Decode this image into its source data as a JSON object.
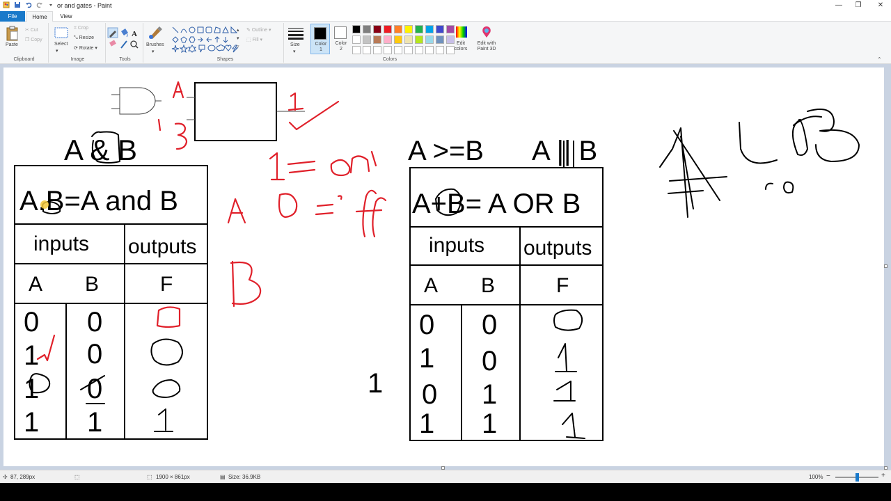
{
  "window": {
    "title": "or and gates - Paint",
    "minimize_glyph": "—",
    "maximize_glyph": "❐",
    "close_glyph": "✕"
  },
  "tabs": {
    "file": "File",
    "home": "Home",
    "view": "View"
  },
  "ribbon": {
    "clipboard": {
      "paste": "Paste",
      "cut": "Cut",
      "copy": "Copy",
      "label": "Clipboard"
    },
    "image": {
      "select": "Select",
      "crop": "Crop",
      "resize": "Resize",
      "rotate": "Rotate",
      "label": "Image"
    },
    "tools": {
      "label": "Tools",
      "brushes": "Brushes"
    },
    "shapes": {
      "outline": "Outline",
      "fill": "Fill",
      "label": "Shapes"
    },
    "size": {
      "label": "Size"
    },
    "colors": {
      "color1": "Color 1",
      "color2": "Color 2",
      "edit_colors": "Edit colors",
      "paint3d": "Edit with Paint 3D",
      "label": "Colors",
      "palette_row1": [
        "#000000",
        "#7f7f7f",
        "#880015",
        "#ed1c24",
        "#ff7f27",
        "#fff200",
        "#22b14c",
        "#00a2e8",
        "#3f48cc",
        "#a349a4"
      ],
      "palette_row2": [
        "#ffffff",
        "#c3c3c3",
        "#b97a57",
        "#ffaec9",
        "#ffc90e",
        "#efe4b0",
        "#b5e61d",
        "#99d9ea",
        "#7092be",
        "#c8bfe7"
      ],
      "color1_value": "#000000",
      "color2_value": "#ffffff"
    }
  },
  "canvas": {
    "left_heading": "A & B",
    "left_formula": "A.B=A and B",
    "left_table": {
      "inputs": "inputs",
      "outputs": "outputs",
      "col_a": "A",
      "col_b": "B",
      "col_f": "F",
      "rows": [
        [
          "0",
          "0"
        ],
        [
          "1",
          "0"
        ],
        [
          "1",
          "0"
        ],
        [
          "1",
          "1"
        ]
      ]
    },
    "right_heading_1": "A >=B",
    "right_heading_2": "A || B",
    "right_formula": "A+B= A OR B",
    "right_table": {
      "inputs": "inputs",
      "outputs": "outputs",
      "col_a": "A",
      "col_b": "B",
      "col_f": "F",
      "rows": [
        [
          "0",
          "0"
        ],
        [
          "1",
          "0"
        ],
        [
          "0",
          "1"
        ],
        [
          "1",
          "1"
        ]
      ]
    },
    "stray_one": "1"
  },
  "status": {
    "cursor": "87, 289px",
    "dimensions": "1900 × 861px",
    "size": "Size: 36.9KB",
    "zoom": "100%",
    "zoom_level": 0.5
  }
}
